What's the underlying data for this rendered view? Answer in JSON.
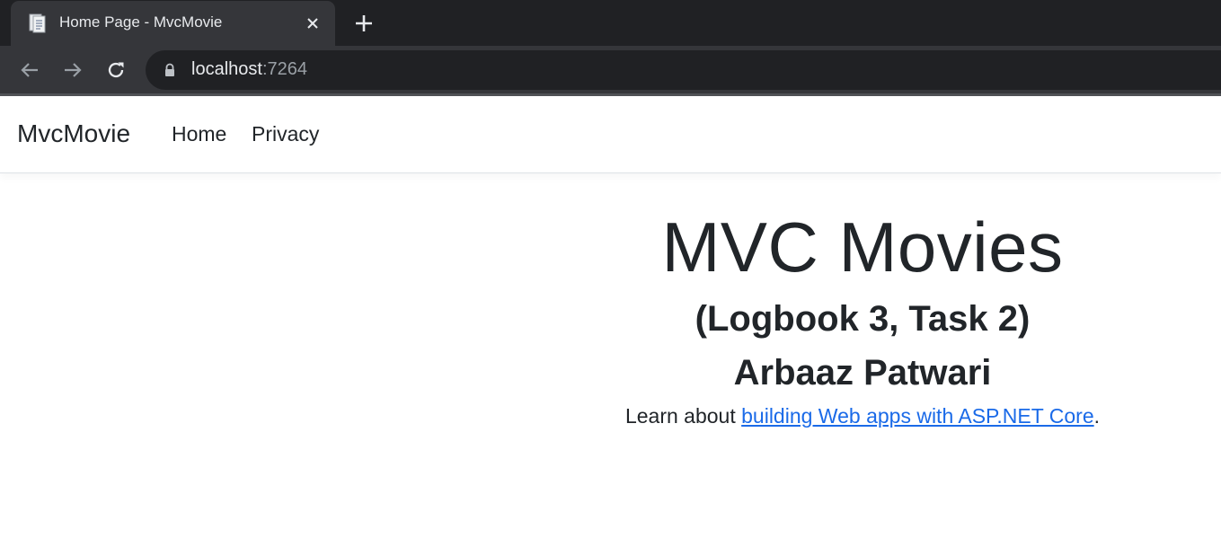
{
  "browser": {
    "tab": {
      "title": "Home Page - MvcMovie",
      "favicon": "document-icon"
    },
    "address": {
      "host": "localhost",
      "port": ":7264"
    },
    "icons": [
      "back-arrow-icon",
      "forward-arrow-icon",
      "reload-icon",
      "lock-icon",
      "close-icon",
      "plus-icon"
    ]
  },
  "navbar": {
    "brand": "MvcMovie",
    "links": [
      {
        "label": "Home"
      },
      {
        "label": "Privacy"
      }
    ]
  },
  "main": {
    "heading": "MVC Movies",
    "subheading": "(Logbook 3, Task 2)",
    "author": "Arbaaz Patwari",
    "learn_prefix": "Learn about ",
    "learn_link": "building Web apps with ASP.NET Core",
    "learn_suffix": "."
  },
  "colors": {
    "chrome_dark": "#202124",
    "chrome_tab": "#35363a",
    "link": "#1a6ae8",
    "text": "#212529"
  }
}
